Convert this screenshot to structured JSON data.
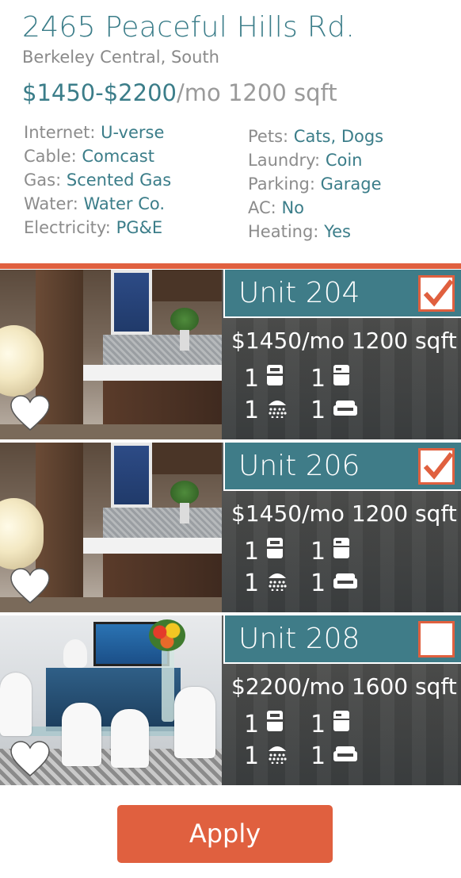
{
  "listing": {
    "address": "2465 Peaceful Hills Rd.",
    "neighborhood": "Berkeley Central, South",
    "price_range": "$1450-$2200",
    "per_month": "/mo",
    "sqft": "1200 sqft"
  },
  "utilities": [
    {
      "label": "Internet:",
      "value": "U-verse"
    },
    {
      "label": "Cable:",
      "value": "Comcast"
    },
    {
      "label": "Gas:",
      "value": "Scented Gas"
    },
    {
      "label": "Water:",
      "value": "Water Co."
    },
    {
      "label": "Electricity:",
      "value": "PG&E"
    }
  ],
  "amenities": [
    {
      "label": "Pets:",
      "value": "Cats, Dogs"
    },
    {
      "label": "Laundry:",
      "value": "Coin"
    },
    {
      "label": "Parking:",
      "value": "Garage"
    },
    {
      "label": "AC:",
      "value": "No"
    },
    {
      "label": "Heating:",
      "value": "Yes"
    }
  ],
  "units": [
    {
      "name": "Unit 204",
      "price": "$1450/mo 1200 sqft",
      "checked": true,
      "counts": {
        "washer": "1",
        "fridge": "1",
        "bath": "1",
        "couch": "1"
      }
    },
    {
      "name": "Unit 206",
      "price": "$1450/mo 1200 sqft",
      "checked": true,
      "counts": {
        "washer": "1",
        "fridge": "1",
        "bath": "1",
        "couch": "1"
      }
    },
    {
      "name": "Unit 208",
      "price": "$2200/mo 1600 sqft",
      "checked": false,
      "counts": {
        "washer": "1",
        "fridge": "1",
        "bath": "1",
        "couch": "1"
      }
    }
  ],
  "icons": {
    "washer": "washer-icon",
    "fridge": "fridge-icon",
    "bath": "shower-icon",
    "couch": "couch-icon",
    "favorite": "heart-icon",
    "check": "checkmark-icon"
  },
  "actions": {
    "apply_label": "Apply"
  },
  "colors": {
    "accent": "#e0603f",
    "teal": "#3f7c88"
  }
}
